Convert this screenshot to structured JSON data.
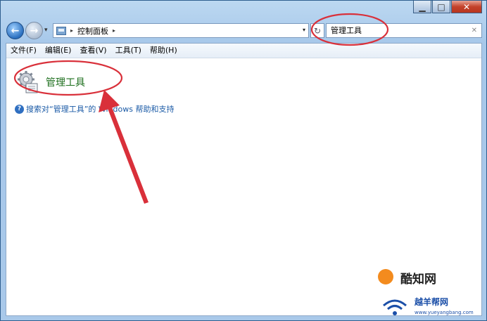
{
  "window": {
    "caption_buttons": [
      {
        "name": "minimize-button",
        "glyph": "▁"
      },
      {
        "name": "maximize-button",
        "glyph": "□"
      },
      {
        "name": "close-button",
        "glyph": "✕"
      }
    ]
  },
  "navigation": {
    "back_glyph": "←",
    "forward_glyph": "→",
    "recent_glyph": "▾",
    "address": {
      "breadcrumb": [
        "控制面板"
      ],
      "sep_glyph": "▸",
      "dropdown_glyph": "▾"
    },
    "refresh_glyph": "↻",
    "search": {
      "value": "管理工具",
      "clear_glyph": "✕"
    }
  },
  "menu": {
    "items": [
      "文件(F)",
      "编辑(E)",
      "查看(V)",
      "工具(T)",
      "帮助(H)"
    ]
  },
  "results": {
    "item_title": "管理工具",
    "help_icon_glyph": "?",
    "help_text": "搜索对“管理工具”的 Windows 帮助和支持"
  },
  "annotations": {
    "color": "#d9303a"
  },
  "watermark": {
    "line1": "酷知网",
    "line2": "越羊帮网",
    "url": "www.yueyangbang.com"
  }
}
